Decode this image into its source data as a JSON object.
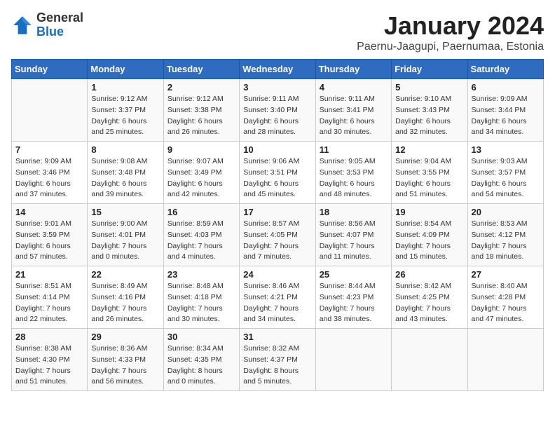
{
  "logo": {
    "general": "General",
    "blue": "Blue"
  },
  "title": "January 2024",
  "subtitle": "Paernu-Jaagupi, Paernumaa, Estonia",
  "weekdays": [
    "Sunday",
    "Monday",
    "Tuesday",
    "Wednesday",
    "Thursday",
    "Friday",
    "Saturday"
  ],
  "weeks": [
    [
      {
        "day": "",
        "info": ""
      },
      {
        "day": "1",
        "info": "Sunrise: 9:12 AM\nSunset: 3:37 PM\nDaylight: 6 hours\nand 25 minutes."
      },
      {
        "day": "2",
        "info": "Sunrise: 9:12 AM\nSunset: 3:38 PM\nDaylight: 6 hours\nand 26 minutes."
      },
      {
        "day": "3",
        "info": "Sunrise: 9:11 AM\nSunset: 3:40 PM\nDaylight: 6 hours\nand 28 minutes."
      },
      {
        "day": "4",
        "info": "Sunrise: 9:11 AM\nSunset: 3:41 PM\nDaylight: 6 hours\nand 30 minutes."
      },
      {
        "day": "5",
        "info": "Sunrise: 9:10 AM\nSunset: 3:43 PM\nDaylight: 6 hours\nand 32 minutes."
      },
      {
        "day": "6",
        "info": "Sunrise: 9:09 AM\nSunset: 3:44 PM\nDaylight: 6 hours\nand 34 minutes."
      }
    ],
    [
      {
        "day": "7",
        "info": "Sunrise: 9:09 AM\nSunset: 3:46 PM\nDaylight: 6 hours\nand 37 minutes."
      },
      {
        "day": "8",
        "info": "Sunrise: 9:08 AM\nSunset: 3:48 PM\nDaylight: 6 hours\nand 39 minutes."
      },
      {
        "day": "9",
        "info": "Sunrise: 9:07 AM\nSunset: 3:49 PM\nDaylight: 6 hours\nand 42 minutes."
      },
      {
        "day": "10",
        "info": "Sunrise: 9:06 AM\nSunset: 3:51 PM\nDaylight: 6 hours\nand 45 minutes."
      },
      {
        "day": "11",
        "info": "Sunrise: 9:05 AM\nSunset: 3:53 PM\nDaylight: 6 hours\nand 48 minutes."
      },
      {
        "day": "12",
        "info": "Sunrise: 9:04 AM\nSunset: 3:55 PM\nDaylight: 6 hours\nand 51 minutes."
      },
      {
        "day": "13",
        "info": "Sunrise: 9:03 AM\nSunset: 3:57 PM\nDaylight: 6 hours\nand 54 minutes."
      }
    ],
    [
      {
        "day": "14",
        "info": "Sunrise: 9:01 AM\nSunset: 3:59 PM\nDaylight: 6 hours\nand 57 minutes."
      },
      {
        "day": "15",
        "info": "Sunrise: 9:00 AM\nSunset: 4:01 PM\nDaylight: 7 hours\nand 0 minutes."
      },
      {
        "day": "16",
        "info": "Sunrise: 8:59 AM\nSunset: 4:03 PM\nDaylight: 7 hours\nand 4 minutes."
      },
      {
        "day": "17",
        "info": "Sunrise: 8:57 AM\nSunset: 4:05 PM\nDaylight: 7 hours\nand 7 minutes."
      },
      {
        "day": "18",
        "info": "Sunrise: 8:56 AM\nSunset: 4:07 PM\nDaylight: 7 hours\nand 11 minutes."
      },
      {
        "day": "19",
        "info": "Sunrise: 8:54 AM\nSunset: 4:09 PM\nDaylight: 7 hours\nand 15 minutes."
      },
      {
        "day": "20",
        "info": "Sunrise: 8:53 AM\nSunset: 4:12 PM\nDaylight: 7 hours\nand 18 minutes."
      }
    ],
    [
      {
        "day": "21",
        "info": "Sunrise: 8:51 AM\nSunset: 4:14 PM\nDaylight: 7 hours\nand 22 minutes."
      },
      {
        "day": "22",
        "info": "Sunrise: 8:49 AM\nSunset: 4:16 PM\nDaylight: 7 hours\nand 26 minutes."
      },
      {
        "day": "23",
        "info": "Sunrise: 8:48 AM\nSunset: 4:18 PM\nDaylight: 7 hours\nand 30 minutes."
      },
      {
        "day": "24",
        "info": "Sunrise: 8:46 AM\nSunset: 4:21 PM\nDaylight: 7 hours\nand 34 minutes."
      },
      {
        "day": "25",
        "info": "Sunrise: 8:44 AM\nSunset: 4:23 PM\nDaylight: 7 hours\nand 38 minutes."
      },
      {
        "day": "26",
        "info": "Sunrise: 8:42 AM\nSunset: 4:25 PM\nDaylight: 7 hours\nand 43 minutes."
      },
      {
        "day": "27",
        "info": "Sunrise: 8:40 AM\nSunset: 4:28 PM\nDaylight: 7 hours\nand 47 minutes."
      }
    ],
    [
      {
        "day": "28",
        "info": "Sunrise: 8:38 AM\nSunset: 4:30 PM\nDaylight: 7 hours\nand 51 minutes."
      },
      {
        "day": "29",
        "info": "Sunrise: 8:36 AM\nSunset: 4:33 PM\nDaylight: 7 hours\nand 56 minutes."
      },
      {
        "day": "30",
        "info": "Sunrise: 8:34 AM\nSunset: 4:35 PM\nDaylight: 8 hours\nand 0 minutes."
      },
      {
        "day": "31",
        "info": "Sunrise: 8:32 AM\nSunset: 4:37 PM\nDaylight: 8 hours\nand 5 minutes."
      },
      {
        "day": "",
        "info": ""
      },
      {
        "day": "",
        "info": ""
      },
      {
        "day": "",
        "info": ""
      }
    ]
  ]
}
